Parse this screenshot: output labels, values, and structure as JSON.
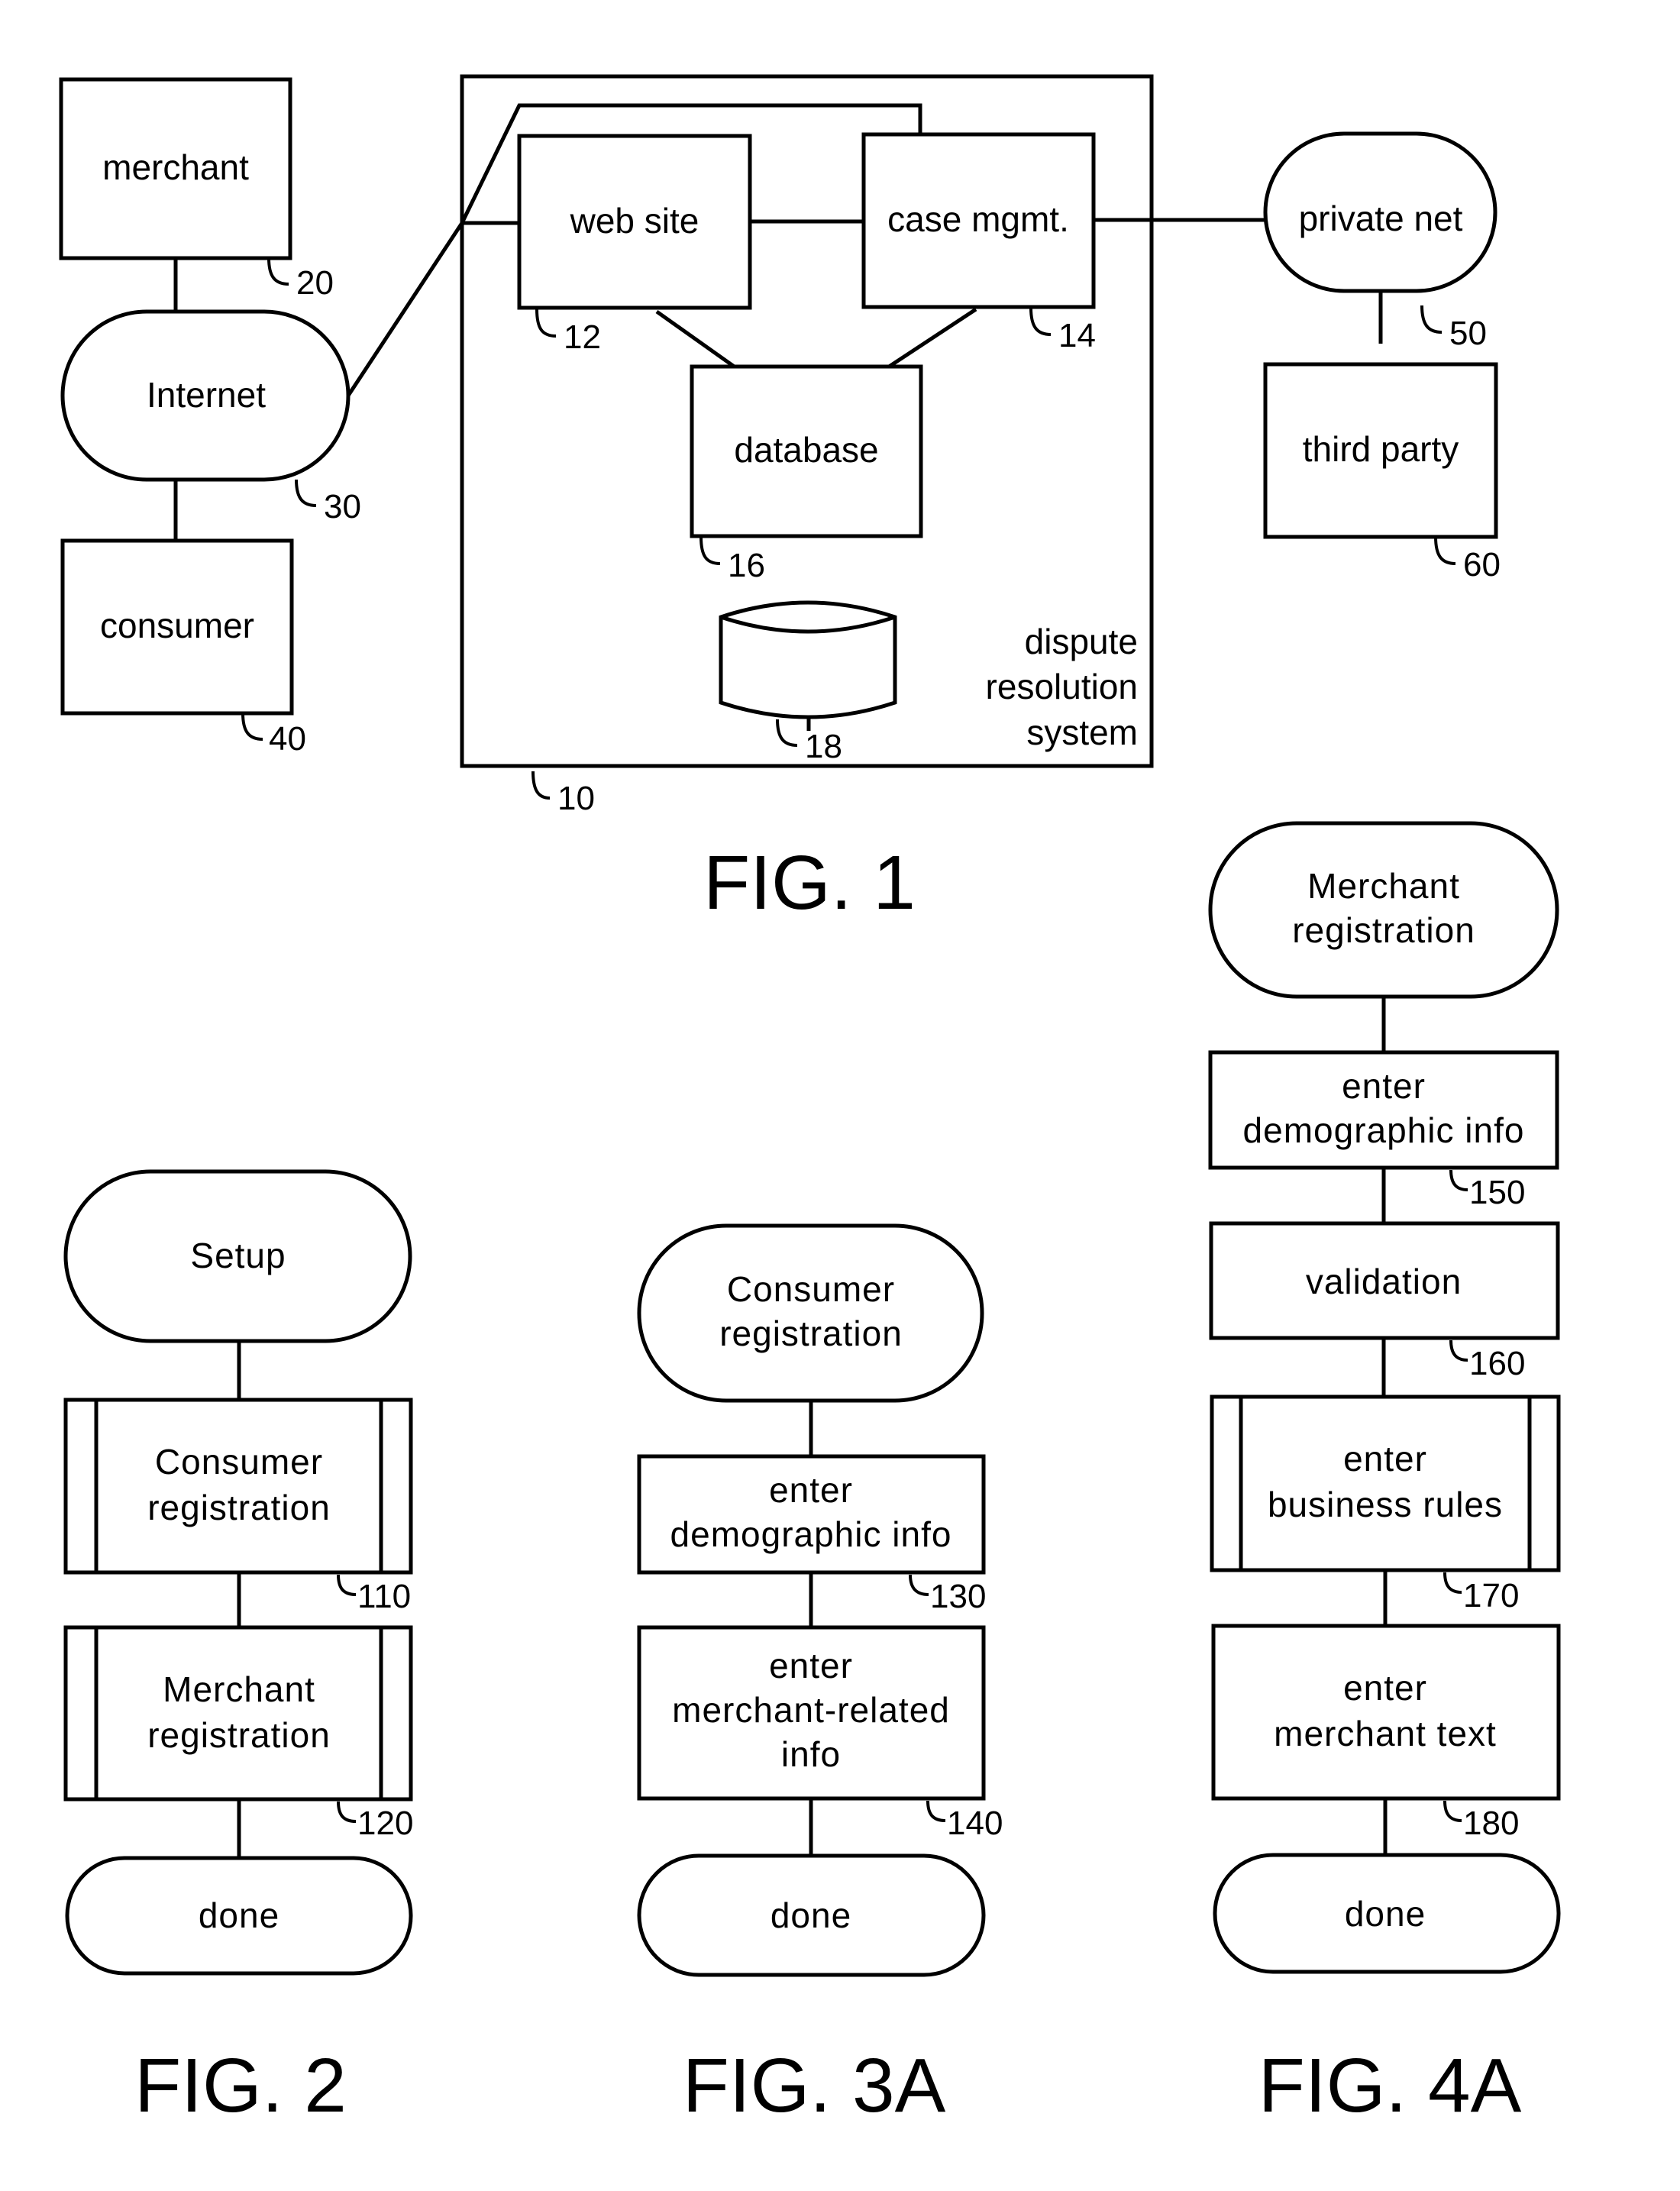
{
  "fig1": {
    "caption": "FIG. 1",
    "merchant": {
      "label": "merchant",
      "ref": "20"
    },
    "internet": {
      "label": "Internet",
      "ref": "30"
    },
    "consumer": {
      "label": "consumer",
      "ref": "40"
    },
    "system": {
      "label_lines": [
        "dispute",
        "resolution",
        "system"
      ],
      "ref": "10"
    },
    "web_site": {
      "label": "web site",
      "ref": "12"
    },
    "case_mgmt": {
      "label": "case mgmt.",
      "ref": "14"
    },
    "database": {
      "label": "database",
      "ref": "16"
    },
    "storage": {
      "ref": "18"
    },
    "private_net": {
      "label": "private net",
      "ref": "50"
    },
    "third_party": {
      "label": "third party",
      "ref": "60"
    }
  },
  "fig2": {
    "caption": "FIG. 2",
    "start": "Setup",
    "steps": [
      {
        "lines": [
          "Consumer",
          "registration"
        ],
        "ref": "110",
        "type": "subprocess"
      },
      {
        "lines": [
          "Merchant",
          "registration"
        ],
        "ref": "120",
        "type": "subprocess"
      }
    ],
    "end": "done"
  },
  "fig3a": {
    "caption": "FIG. 3A",
    "start_lines": [
      "Consumer",
      "registration"
    ],
    "steps": [
      {
        "lines": [
          "enter",
          "demographic info"
        ],
        "ref": "130",
        "type": "process"
      },
      {
        "lines": [
          "enter",
          "merchant-related",
          "info"
        ],
        "ref": "140",
        "type": "process"
      }
    ],
    "end": "done"
  },
  "fig4a": {
    "caption": "FIG. 4A",
    "start_lines": [
      "Merchant",
      "registration"
    ],
    "steps": [
      {
        "lines": [
          "enter",
          "demographic info"
        ],
        "ref": "150",
        "type": "process"
      },
      {
        "lines": [
          "validation"
        ],
        "ref": "160",
        "type": "process"
      },
      {
        "lines": [
          "enter",
          "business rules"
        ],
        "ref": "170",
        "type": "subprocess"
      },
      {
        "lines": [
          "enter",
          "merchant text"
        ],
        "ref": "180",
        "type": "process"
      }
    ],
    "end": "done"
  }
}
